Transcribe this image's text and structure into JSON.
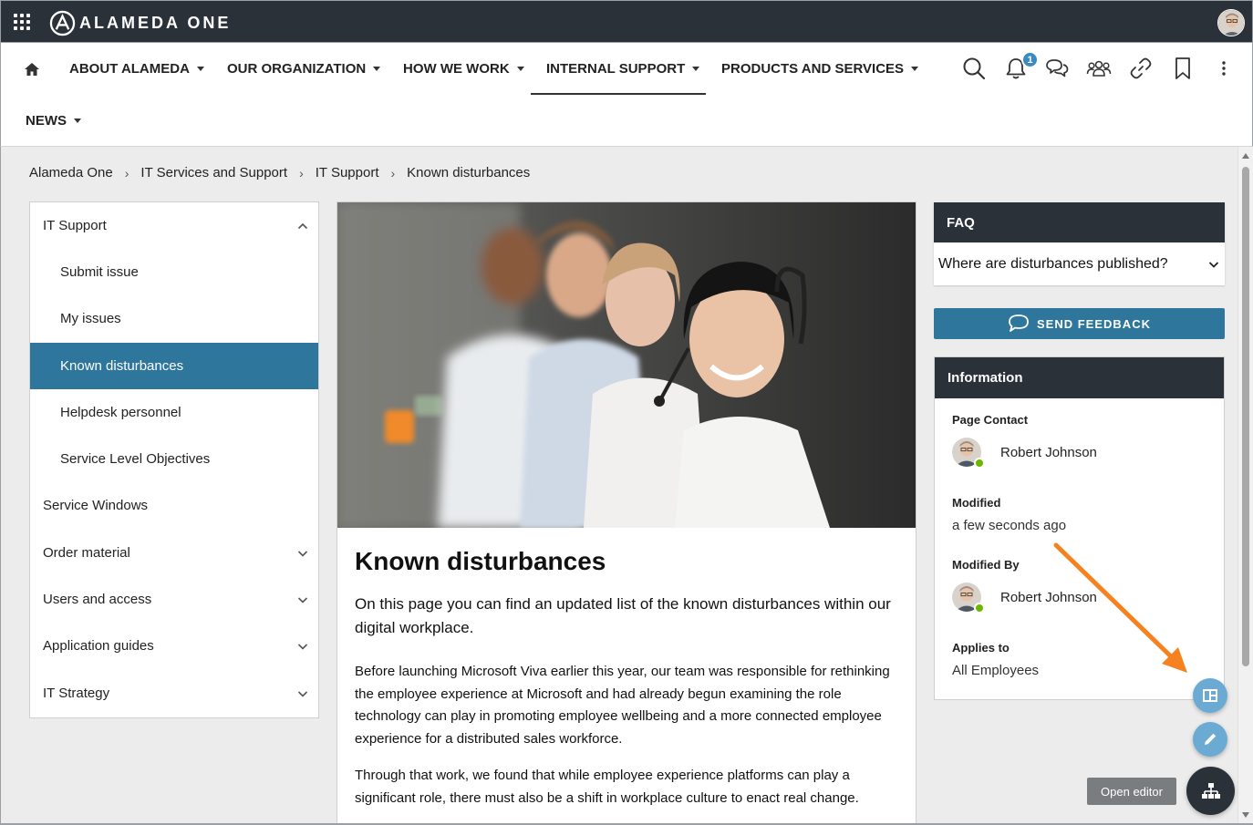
{
  "app": {
    "brand": "ALAMEDA ONE"
  },
  "nav": {
    "items": [
      {
        "label": "ABOUT ALAMEDA"
      },
      {
        "label": "OUR ORGANIZATION"
      },
      {
        "label": "HOW WE WORK"
      },
      {
        "label": "INTERNAL SUPPORT"
      },
      {
        "label": "PRODUCTS AND SERVICES"
      },
      {
        "label": "NEWS"
      }
    ],
    "active": "INTERNAL SUPPORT",
    "notification_count": "1",
    "icons": [
      "home-icon",
      "search-icon",
      "bell-icon",
      "chat-icon",
      "people-icon",
      "link-icon",
      "bookmark-icon",
      "more-vertical-icon"
    ]
  },
  "breadcrumb": [
    "Alameda One",
    "IT Services and Support",
    "IT Support",
    "Known disturbances"
  ],
  "sidebar": {
    "items": [
      {
        "label": "IT Support",
        "level": 1,
        "chevron": "up"
      },
      {
        "label": "Submit issue",
        "level": 2
      },
      {
        "label": "My issues",
        "level": 2
      },
      {
        "label": "Known disturbances",
        "level": 2,
        "active": true
      },
      {
        "label": "Helpdesk personnel",
        "level": 2
      },
      {
        "label": "Service Level Objectives",
        "level": 2
      },
      {
        "label": "Service Windows",
        "level": 1
      },
      {
        "label": "Order material",
        "level": 1,
        "chevron": "down"
      },
      {
        "label": "Users and access",
        "level": 1,
        "chevron": "down"
      },
      {
        "label": "Application guides",
        "level": 1,
        "chevron": "down"
      },
      {
        "label": "IT Strategy",
        "level": 1,
        "chevron": "down"
      }
    ]
  },
  "article": {
    "title": "Known disturbances",
    "lead": "On this page you can find an updated list of the known disturbances within our digital workplace.",
    "paragraphs": [
      "Before launching Microsoft Viva earlier this year, our team was responsible for rethinking the employee experience at Microsoft and had already begun examining the role technology can play in promoting employee wellbeing and a more connected employee experience for a distributed sales workforce.",
      "Through that work, we found that while employee experience platforms can play a significant role, there must also be a shift in workplace culture to enact real change."
    ]
  },
  "faq": {
    "title": "FAQ",
    "question": "Where are disturbances published?"
  },
  "feedback": {
    "label": "SEND FEEDBACK"
  },
  "information": {
    "title": "Information",
    "page_contact_label": "Page Contact",
    "page_contact": "Robert Johnson",
    "modified_label": "Modified",
    "modified": "a few seconds ago",
    "modified_by_label": "Modified By",
    "modified_by": "Robert Johnson",
    "applies_to_label": "Applies to",
    "applies_to": "All Employees"
  },
  "floating": {
    "tooltip": "Open editor"
  },
  "colors": {
    "topbar": "#2a3139",
    "accent": "#2e769b",
    "fab": "#6aaad3",
    "annotation_arrow": "#f5821f",
    "presence": "#6bb700"
  }
}
